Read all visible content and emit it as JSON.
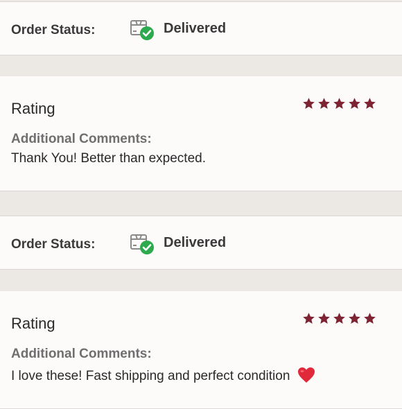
{
  "colors": {
    "star": "#7d2332",
    "check": "#2eaa4e",
    "background": "#ece9e4",
    "card": "#fdfafa",
    "heart": "#e02a3a"
  },
  "entries": [
    {
      "order_status_label": "Order Status:",
      "order_status_value": "Delivered",
      "status_icon": "package-delivered-icon",
      "rating_title": "Rating",
      "rating_stars": 5,
      "comments_label": "Additional Comments:",
      "comment_text": "Thank You! Better than expected."
    },
    {
      "order_status_label": "Order Status:",
      "order_status_value": "Delivered",
      "status_icon": "package-delivered-icon",
      "rating_title": "Rating",
      "rating_stars": 5,
      "comments_label": "Additional Comments:",
      "comment_text": "I love these! Fast shipping and perfect condition",
      "comment_emoji": "heart-emoji-icon"
    }
  ]
}
